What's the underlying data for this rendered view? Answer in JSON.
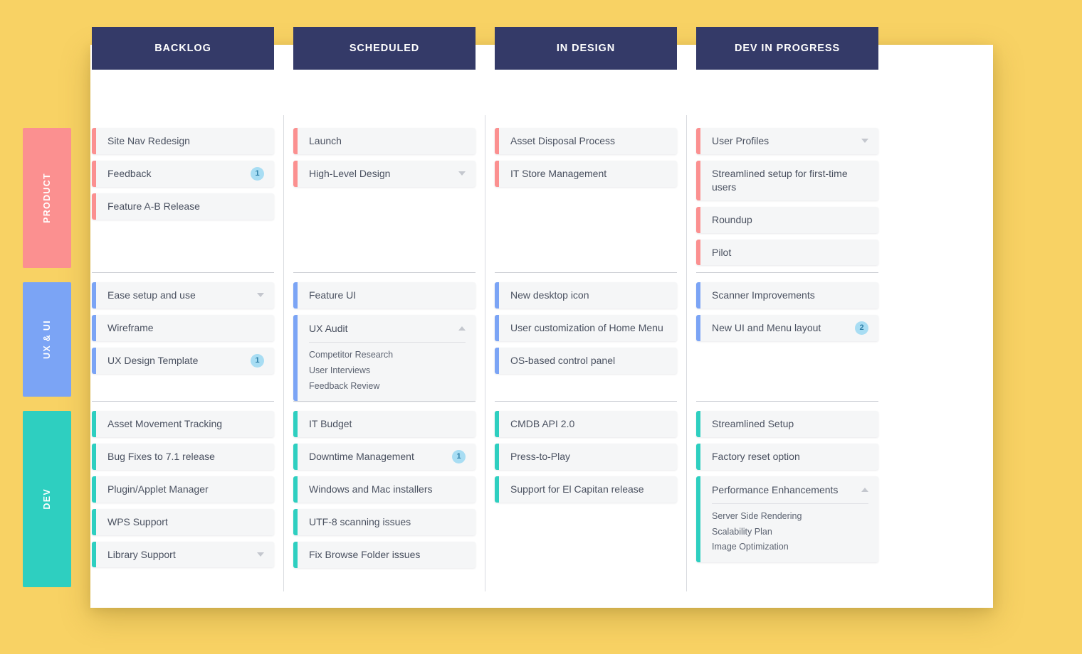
{
  "colors": {
    "page_background": "#f8d264",
    "panel": "#ffffff",
    "header": "#343a68",
    "lane_product": "#fb9090",
    "lane_ux_ui": "#7ba4f5",
    "lane_dev": "#2ecfc0",
    "card_body": "#f5f6f7",
    "badge_bg": "#a8ddf3",
    "badge_text": "#2f7fa8",
    "card_text": "#4a5160"
  },
  "columns": [
    {
      "label": "BACKLOG"
    },
    {
      "label": "SCHEDULED"
    },
    {
      "label": "IN DESIGN"
    },
    {
      "label": "DEV IN PROGRESS"
    }
  ],
  "swimlanes": [
    {
      "label": "PRODUCT",
      "color": "#fb9090",
      "cells": [
        {
          "cards": [
            {
              "title": "Site Nav Redesign"
            },
            {
              "title": "Feedback",
              "badge": "1"
            },
            {
              "title": "Feature A-B Release"
            }
          ]
        },
        {
          "cards": [
            {
              "title": "Launch"
            },
            {
              "title": "High-Level Design",
              "caret": "down"
            }
          ]
        },
        {
          "cards": [
            {
              "title": "Asset Disposal Process"
            },
            {
              "title": "IT Store Management"
            }
          ]
        },
        {
          "cards": [
            {
              "title": "User Profiles",
              "caret": "down"
            },
            {
              "title": "Streamlined setup for first-time users"
            },
            {
              "title": "Roundup"
            },
            {
              "title": "Pilot"
            }
          ]
        }
      ]
    },
    {
      "label": "UX & UI",
      "color": "#7ba4f5",
      "cells": [
        {
          "cards": [
            {
              "title": "Ease setup and use",
              "caret": "down"
            },
            {
              "title": "Wireframe"
            },
            {
              "title": "UX Design Template",
              "badge": "1"
            }
          ]
        },
        {
          "cards": [
            {
              "title": "Feature UI"
            },
            {
              "title": "UX Audit",
              "caret": "up",
              "expanded": true,
              "sub_items": [
                "Competitor Research",
                "User Interviews",
                "Feedback Review"
              ]
            }
          ]
        },
        {
          "cards": [
            {
              "title": "New desktop icon"
            },
            {
              "title": "User customization of Home Menu"
            },
            {
              "title": "OS-based control panel"
            }
          ]
        },
        {
          "cards": [
            {
              "title": "Scanner Improvements"
            },
            {
              "title": "New UI and Menu layout",
              "badge": "2"
            }
          ]
        }
      ]
    },
    {
      "label": "DEV",
      "color": "#2ecfc0",
      "cells": [
        {
          "cards": [
            {
              "title": "Asset Movement Tracking"
            },
            {
              "title": "Bug Fixes to 7.1 release"
            },
            {
              "title": "Plugin/Applet Manager"
            },
            {
              "title": "WPS Support"
            },
            {
              "title": "Library Support",
              "caret": "down"
            }
          ]
        },
        {
          "cards": [
            {
              "title": "IT Budget"
            },
            {
              "title": "Downtime Management",
              "badge": "1"
            },
            {
              "title": "Windows and Mac installers"
            },
            {
              "title": "UTF-8 scanning issues"
            },
            {
              "title": "Fix Browse Folder issues"
            }
          ]
        },
        {
          "cards": [
            {
              "title": "CMDB API 2.0"
            },
            {
              "title": "Press-to-Play"
            },
            {
              "title": "Support for El Capitan release"
            }
          ]
        },
        {
          "cards": [
            {
              "title": "Streamlined Setup"
            },
            {
              "title": "Factory reset option"
            },
            {
              "title": "Performance Enhancements",
              "caret": "up",
              "expanded": true,
              "sub_items": [
                "Server Side Rendering",
                "Scalability Plan",
                "Image Optimization"
              ]
            }
          ]
        }
      ]
    }
  ]
}
